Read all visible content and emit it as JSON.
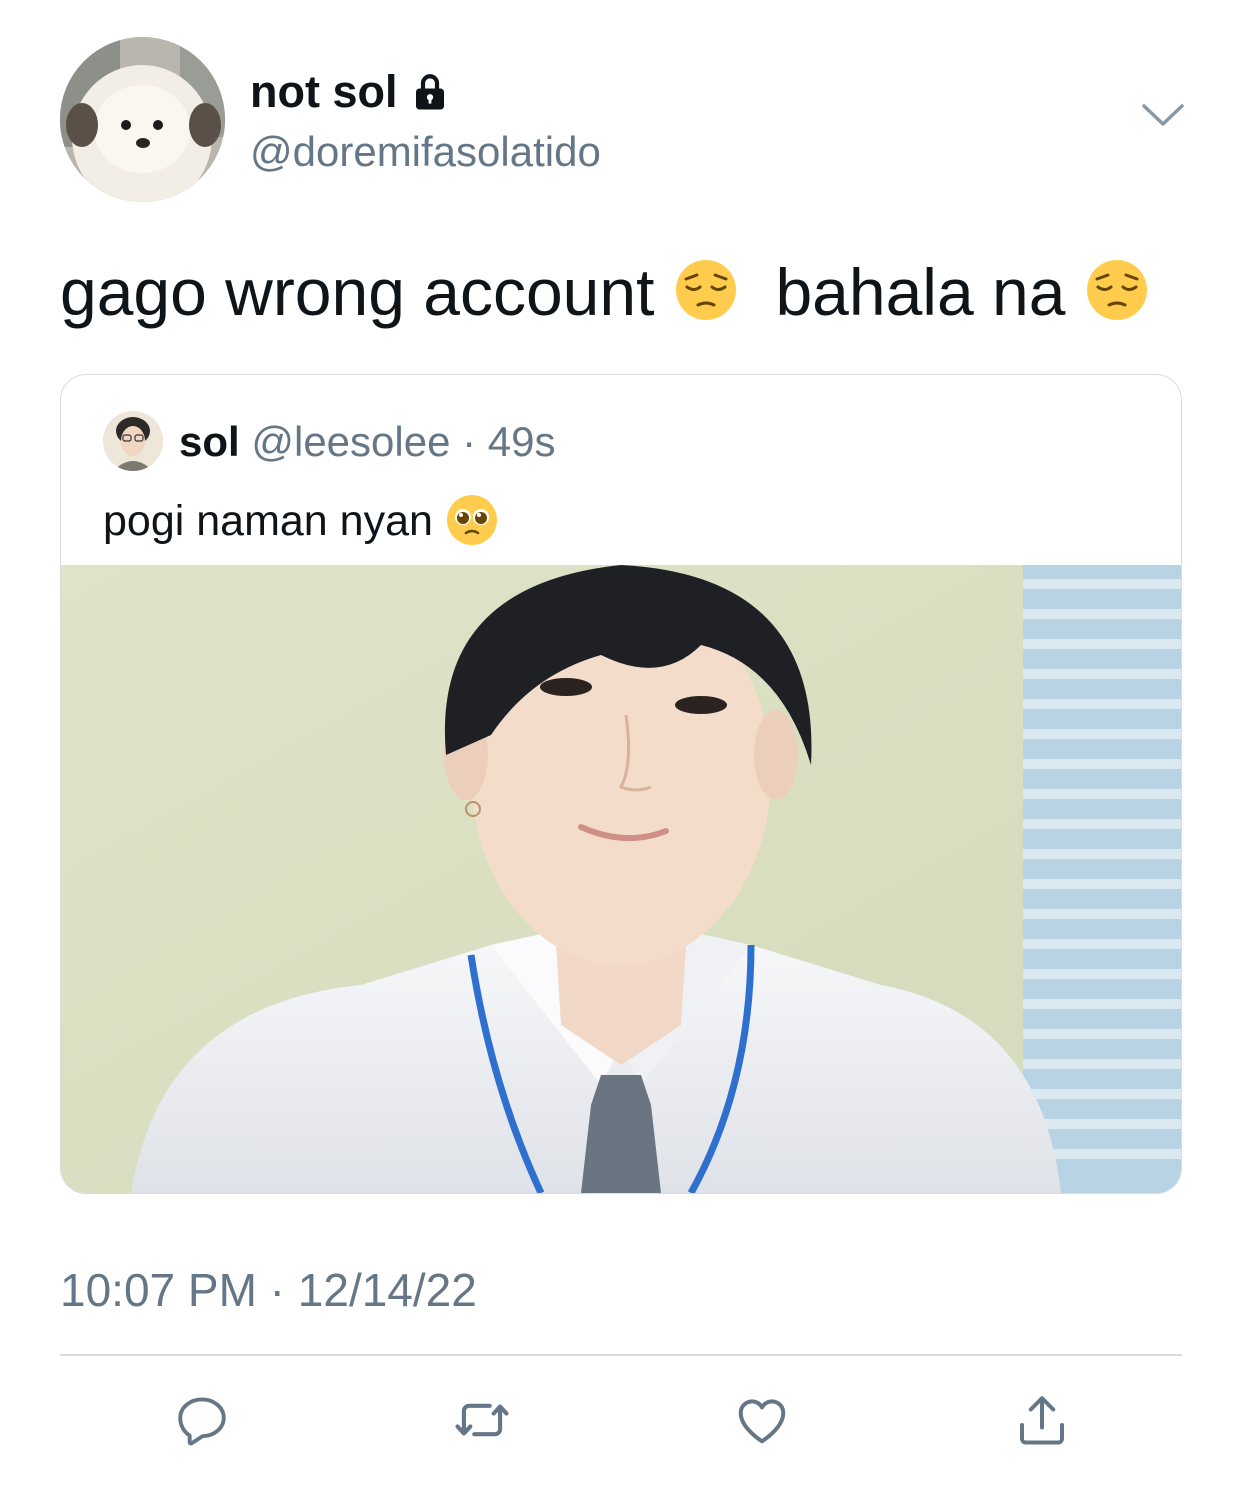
{
  "tweet": {
    "author": {
      "display_name": "not sol",
      "handle": "@doremifasolatido",
      "protected_icon": "lock-icon",
      "avatar_icon": "dog-avatar"
    },
    "text_part1": "gago wrong account",
    "text_part2": "bahala na",
    "emoji": "pensive-face-emoji",
    "timestamp": "10:07 PM · 12/14/22"
  },
  "quoted_tweet": {
    "display_name": "sol",
    "handle": "@leesolee",
    "separator": "·",
    "time": "49s",
    "text": "pogi naman nyan",
    "emoji": "pleading-face-emoji",
    "media": "photo of a young man in a white shirt, tie and blue lanyard"
  },
  "actions": [
    {
      "icon": "reply-icon"
    },
    {
      "icon": "retweet-icon"
    },
    {
      "icon": "like-icon"
    },
    {
      "icon": "share-icon"
    }
  ],
  "colors": {
    "text": "#0f1419",
    "secondary": "#657786",
    "border": "#d6dce0",
    "icon": "#657786"
  }
}
